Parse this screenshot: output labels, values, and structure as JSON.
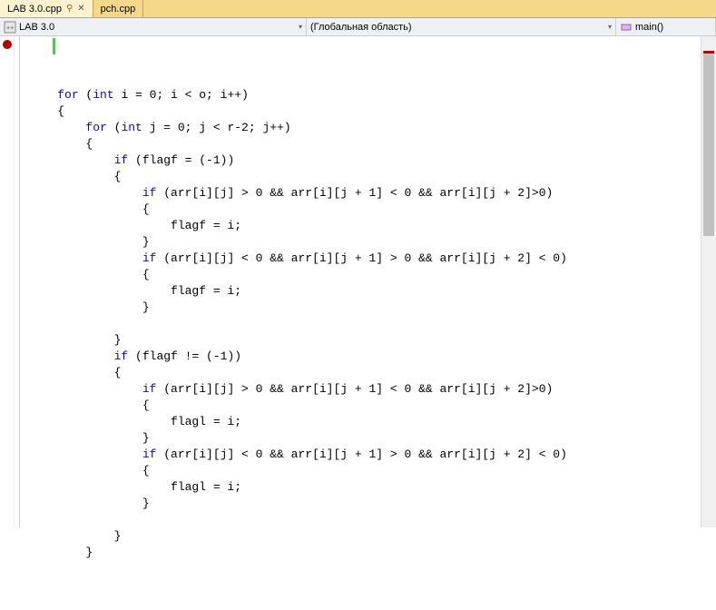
{
  "tabs": {
    "items": [
      {
        "label": "LAB 3.0.cpp",
        "pinned": true,
        "active": true
      },
      {
        "label": "pch.cpp",
        "pinned": false,
        "active": false
      }
    ]
  },
  "navbar": {
    "file": "LAB 3.0",
    "scope": "(Глобальная область)",
    "function": "main()"
  },
  "code": {
    "lines": [
      "    for (int i = 0; i < o; i++)",
      "    {",
      "        for (int j = 0; j < r-2; j++)",
      "        {",
      "            if (flagf = (-1))",
      "            {",
      "                if (arr[i][j] > 0 && arr[i][j + 1] < 0 && arr[i][j + 2]>0)",
      "                {",
      "                    flagf = i;",
      "                }",
      "                if (arr[i][j] < 0 && arr[i][j + 1] > 0 && arr[i][j + 2] < 0)",
      "                {",
      "                    flagf = i;",
      "                }",
      "",
      "            }",
      "            if (flagf != (-1))",
      "            {",
      "                if (arr[i][j] > 0 && arr[i][j + 1] < 0 && arr[i][j + 2]>0)",
      "                {",
      "                    flagl = i;",
      "                }",
      "                if (arr[i][j] < 0 && arr[i][j + 1] > 0 && arr[i][j + 2] < 0)",
      "                {",
      "                    flagl = i;",
      "                }",
      "",
      "            }",
      "        }",
      ""
    ],
    "keywords": [
      "for",
      "int",
      "if"
    ]
  }
}
